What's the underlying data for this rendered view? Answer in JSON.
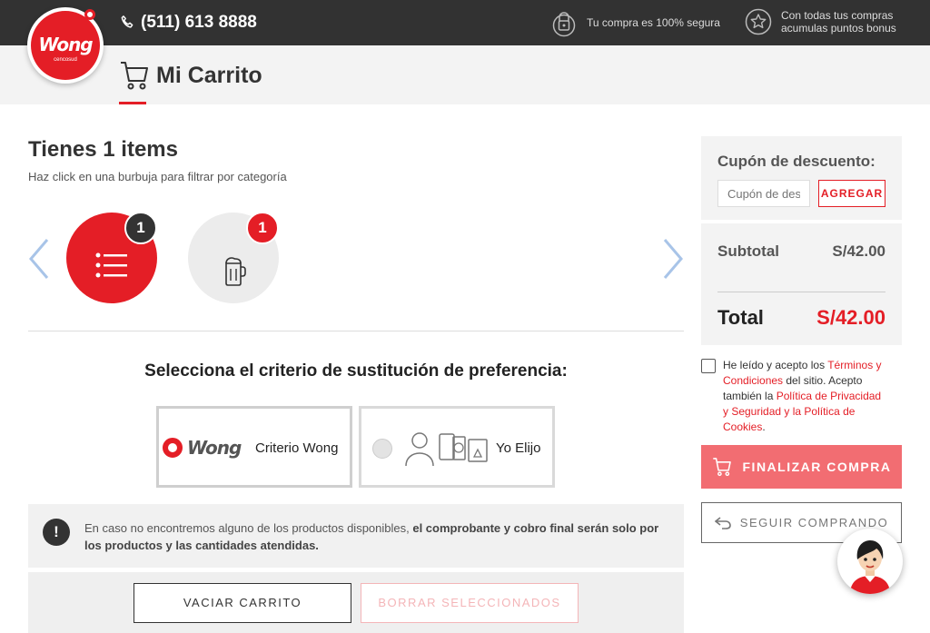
{
  "topbar": {
    "logo_text": "Wong",
    "logo_sub": "cencosud",
    "phone": "(511) 613 8888",
    "secure_text": "Tu compra es 100% segura",
    "bonus_line1": "Con todas tus compras",
    "bonus_line2": "acumulas puntos bonus"
  },
  "header": {
    "title": "Mi Carrito"
  },
  "items": {
    "title": "Tienes 1 items",
    "subtitle": "Haz click en una burbuja para filtrar por categoría",
    "bubbles": [
      {
        "icon": "list-icon",
        "count": "1"
      },
      {
        "icon": "beer-mug-icon",
        "count": "1"
      }
    ]
  },
  "substitution": {
    "title": "Selecciona el criterio de sustitución de preferencia:",
    "options": [
      {
        "brand": "Wong",
        "label": "Criterio Wong",
        "selected": true
      },
      {
        "label": "Yo Elijo",
        "selected": false
      }
    ]
  },
  "notice": {
    "text": "En caso no encontremos alguno de los productos disponibles, ",
    "bold": "el comprobante y cobro final serán solo por los productos y las cantidades atendidas."
  },
  "actions": {
    "empty_cart": "VACIAR CARRITO",
    "delete_selected": "BORRAR SELECCIONADOS"
  },
  "summary": {
    "coupon_label": "Cupón de descuento:",
    "coupon_placeholder": "Cupón de descuento",
    "coupon_button": "AGREGAR",
    "subtotal_label": "Subtotal",
    "subtotal_value": "S/42.00",
    "total_label": "Total",
    "total_value": "S/42.00"
  },
  "terms": {
    "t1": "He leído y acepto los ",
    "link1": "Términos y Condiciones",
    "t2": " del sitio. Acepto también la ",
    "link2": "Política de Privacidad y Seguridad y la Política de Cookies",
    "t3": "."
  },
  "buttons": {
    "finish": "FINALIZAR COMPRA",
    "continue": "SEGUIR COMPRANDO"
  },
  "colors": {
    "brand_red": "#e41e26",
    "topbar_bg": "#323232",
    "finish_bg": "#f26d72"
  }
}
